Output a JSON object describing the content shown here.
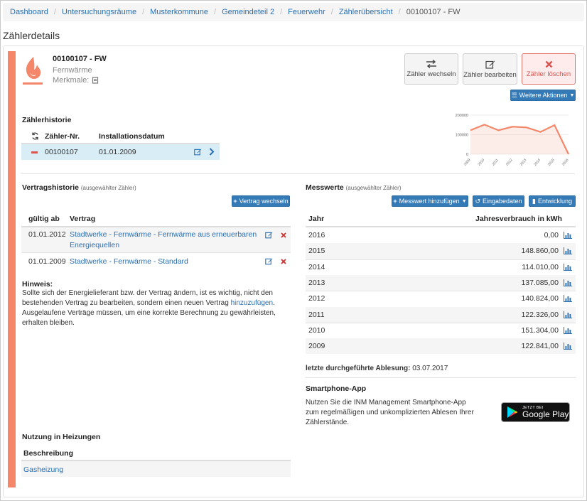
{
  "breadcrumb": [
    "Dashboard",
    "Untersuchungsräume",
    "Musterkommune",
    "Gemeindeteil 2",
    "Feuerwehr",
    "Zählerübersicht"
  ],
  "breadcrumb_current": "00100107 - FW",
  "page_title": "Zählerdetails",
  "meter": {
    "name": "00100107 - FW",
    "type": "Fernwärme",
    "features_label": "Merkmale:"
  },
  "actions": {
    "swap": "Zähler wechseln",
    "edit": "Zähler bearbeiten",
    "delete": "Zähler löschen",
    "more": "Weitere Aktionen"
  },
  "accent_color": "#f4876a",
  "history": {
    "title": "Zählerhistorie",
    "col_nr": "Zähler-Nr.",
    "col_date": "Installationsdatum",
    "rows": [
      {
        "nr": "00100107",
        "date": "01.01.2009"
      }
    ]
  },
  "mini_chart": {
    "y_ticks": [
      "200000",
      "100000",
      "0"
    ],
    "x_ticks": [
      "2009",
      "2010",
      "2011",
      "2012",
      "2013",
      "2014",
      "2015",
      "2016"
    ],
    "values": [
      122841,
      151304,
      122326,
      140824,
      137085,
      114010,
      148860,
      0
    ],
    "ymax": 200000,
    "color": "#f4876a"
  },
  "contracts": {
    "title": "Vertragshistorie",
    "subtitle": "(ausgewählter Zähler)",
    "swap_btn": "Vertrag wechseln",
    "col_valid": "gültig ab",
    "col_contract": "Vertrag",
    "rows": [
      {
        "valid": "01.01.2012",
        "line1": "Stadtwerke - Fernwärme - Fernwärme aus erneuerbaren",
        "line2": "Energiequellen"
      },
      {
        "valid": "01.01.2009",
        "line1": "Stadtwerke - Fernwärme - Standard",
        "line2": ""
      }
    ],
    "hint_title": "Hinweis:",
    "hint_l1": "Sollte sich der Energielieferant bzw. der Vertrag ändern, ist es wichtig, nicht den",
    "hint_l2a": "bestehenden Vertrag zu bearbeiten, sondern einen neuen Vertrag",
    "hint_link": "hinzuzufügen",
    "hint_l2b": ".",
    "hint_l3": "Ausgelaufene Verträge müssen, um eine korrekte Berechnung zu gewährleisten,",
    "hint_l4": "erhalten bleiben."
  },
  "heating": {
    "title": "Nutzung in Heizungen",
    "col_desc": "Beschreibung",
    "rows": [
      "Gasheizung"
    ]
  },
  "measurements": {
    "title": "Messwerte",
    "subtitle": "(ausgewählter Zähler)",
    "add_btn": "Messwert hinzufügen",
    "input_btn": "Eingabedaten",
    "dev_btn": "Entwicklung",
    "col_year": "Jahr",
    "col_cons": "Jahresverbrauch in kWh",
    "rows": [
      {
        "year": "2016",
        "value": "0,00"
      },
      {
        "year": "2015",
        "value": "148.860,00"
      },
      {
        "year": "2014",
        "value": "114.010,00"
      },
      {
        "year": "2013",
        "value": "137.085,00"
      },
      {
        "year": "2012",
        "value": "140.824,00"
      },
      {
        "year": "2011",
        "value": "122.326,00"
      },
      {
        "year": "2010",
        "value": "151.304,00"
      },
      {
        "year": "2009",
        "value": "122.841,00"
      }
    ],
    "last_reading_label": "letzte durchgeführte Ablesung:",
    "last_reading_date": "03.07.2017"
  },
  "app": {
    "title": "Smartphone-App",
    "l1": "Nutzen Sie die INM Management Smartphone-App",
    "l2": "zum regelmäßigen und unkomplizierten Ablesen Ihrer",
    "l3": "Zählerstände.",
    "badge_top": "JETZT BEI",
    "badge_main": "Google Play"
  }
}
